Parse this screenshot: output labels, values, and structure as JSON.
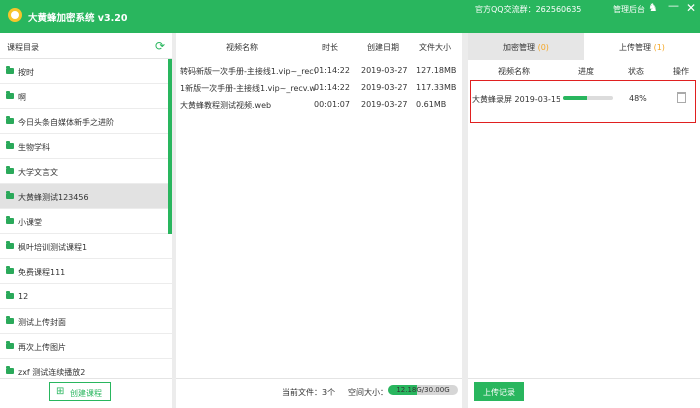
{
  "titlebar": {
    "app_title": "大黄蜂加密系统 v3.20",
    "qq_group": "官方QQ交流群：262560635",
    "admin_link": "管理后台"
  },
  "course_panel": {
    "header": "课程目录",
    "items": [
      {
        "name": "按时"
      },
      {
        "name": "啊"
      },
      {
        "name": "今日头条自媒体新手之进阶"
      },
      {
        "name": "生物学科"
      },
      {
        "name": "大学文言文"
      },
      {
        "name": "大黄蜂测试123456"
      },
      {
        "name": "小课堂"
      },
      {
        "name": "枫叶培训测试课程1"
      },
      {
        "name": "免费课程111"
      },
      {
        "name": "12"
      },
      {
        "name": "测试上传封面"
      },
      {
        "name": "再次上传图片"
      },
      {
        "name": "zxf 测试连续播放2"
      }
    ],
    "active_index": 5,
    "create_button": "创建课程"
  },
  "video_panel": {
    "columns": {
      "name": "视频名称",
      "duration": "时长",
      "created": "创建日期",
      "size": "文件大小"
    },
    "rows": [
      {
        "name": "转码新版一次手册-主接线1.vip~_recv",
        "duration": "01:14:22",
        "created": "2019-03-27",
        "size": "127.18MB"
      },
      {
        "name": "1新版一次手册-主接线1.vip~_recv.wet",
        "duration": "01:14:22",
        "created": "2019-03-27",
        "size": "117.33MB"
      },
      {
        "name": "大黄蜂教程测试视频.web",
        "duration": "00:01:07",
        "created": "2019-03-27",
        "size": "0.61MB"
      }
    ],
    "footer": {
      "file_count_label": "当前文件：3个",
      "space_label": "空间大小：",
      "space_text": "12.18G/30.00G",
      "space_used_fraction": 0.41
    }
  },
  "upload_panel": {
    "tabs": [
      {
        "label": "加密管理 ",
        "count": "(0)"
      },
      {
        "label": "上传管理 ",
        "count": "(1)"
      }
    ],
    "columns": {
      "name": "视频名称",
      "progress": "进度",
      "status": "状态",
      "action": "操作"
    },
    "rows": [
      {
        "name": "大黄蜂录屏 2019-03-15 1",
        "progress_fraction": 0.48,
        "status": "48%"
      }
    ],
    "log_button": "上传记录"
  },
  "colors": {
    "accent": "#29b65e",
    "tab_count": "#f5a623",
    "highlight_border": "#e02020"
  }
}
